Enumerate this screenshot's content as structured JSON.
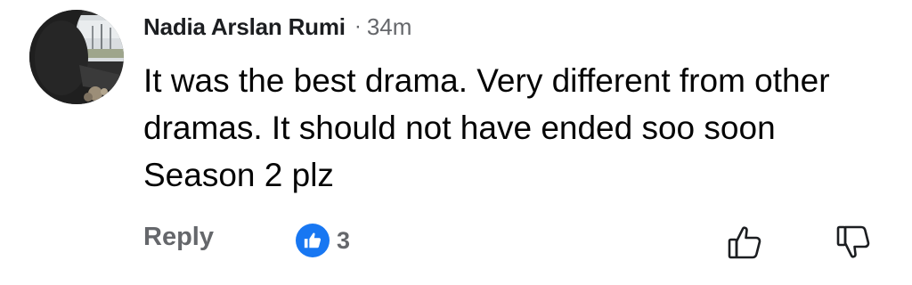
{
  "comment": {
    "author": "Nadia Arslan Rumi",
    "separator": "·",
    "time": "34m",
    "text": "It was the best drama. Very different from other dramas. It should not have ended soo soon   Season 2 plz",
    "reply_label": "Reply",
    "like_count": "3"
  },
  "colors": {
    "like_badge": "#1877f2",
    "meta_text": "#65676b",
    "body_text": "#050505"
  },
  "icons": {
    "reaction": "like-thumb-icon",
    "upvote": "thumbs-up-outline-icon",
    "downvote": "thumbs-down-outline-icon"
  }
}
